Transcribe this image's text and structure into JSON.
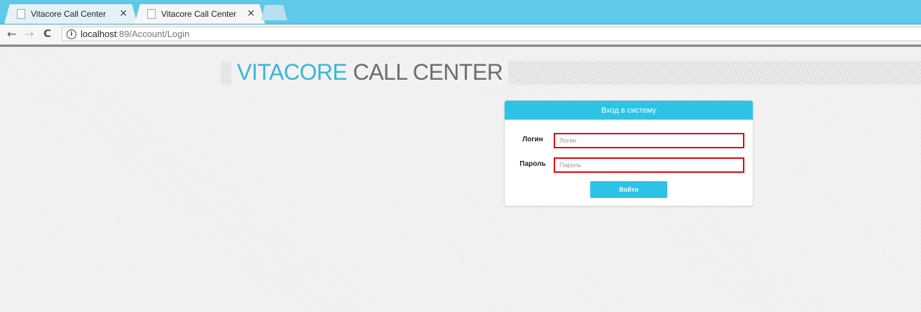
{
  "browser": {
    "tabs": [
      {
        "title": "Vitacore Call Center",
        "close": "×",
        "active": false
      },
      {
        "title": "Vitacore Call Center",
        "close": "×",
        "active": true
      }
    ],
    "nav": {
      "back": "←",
      "forward": "→",
      "reload": "C"
    },
    "address": {
      "info": "i",
      "host": "localhost",
      "rest": ":89/Account/Login"
    }
  },
  "brand": {
    "part1": "VITACORE",
    "part2": "CALL CENTER"
  },
  "login": {
    "header": "Вход в систему",
    "login_label": "Логин",
    "login_placeholder": "Логин",
    "password_label": "Пароль",
    "password_placeholder": "Пароль",
    "submit": "Войти"
  },
  "colors": {
    "accent": "#2dc3e6",
    "brand_blue": "#39b6d9",
    "error_border": "#e00010",
    "tabstrip": "#5ec9e9"
  }
}
